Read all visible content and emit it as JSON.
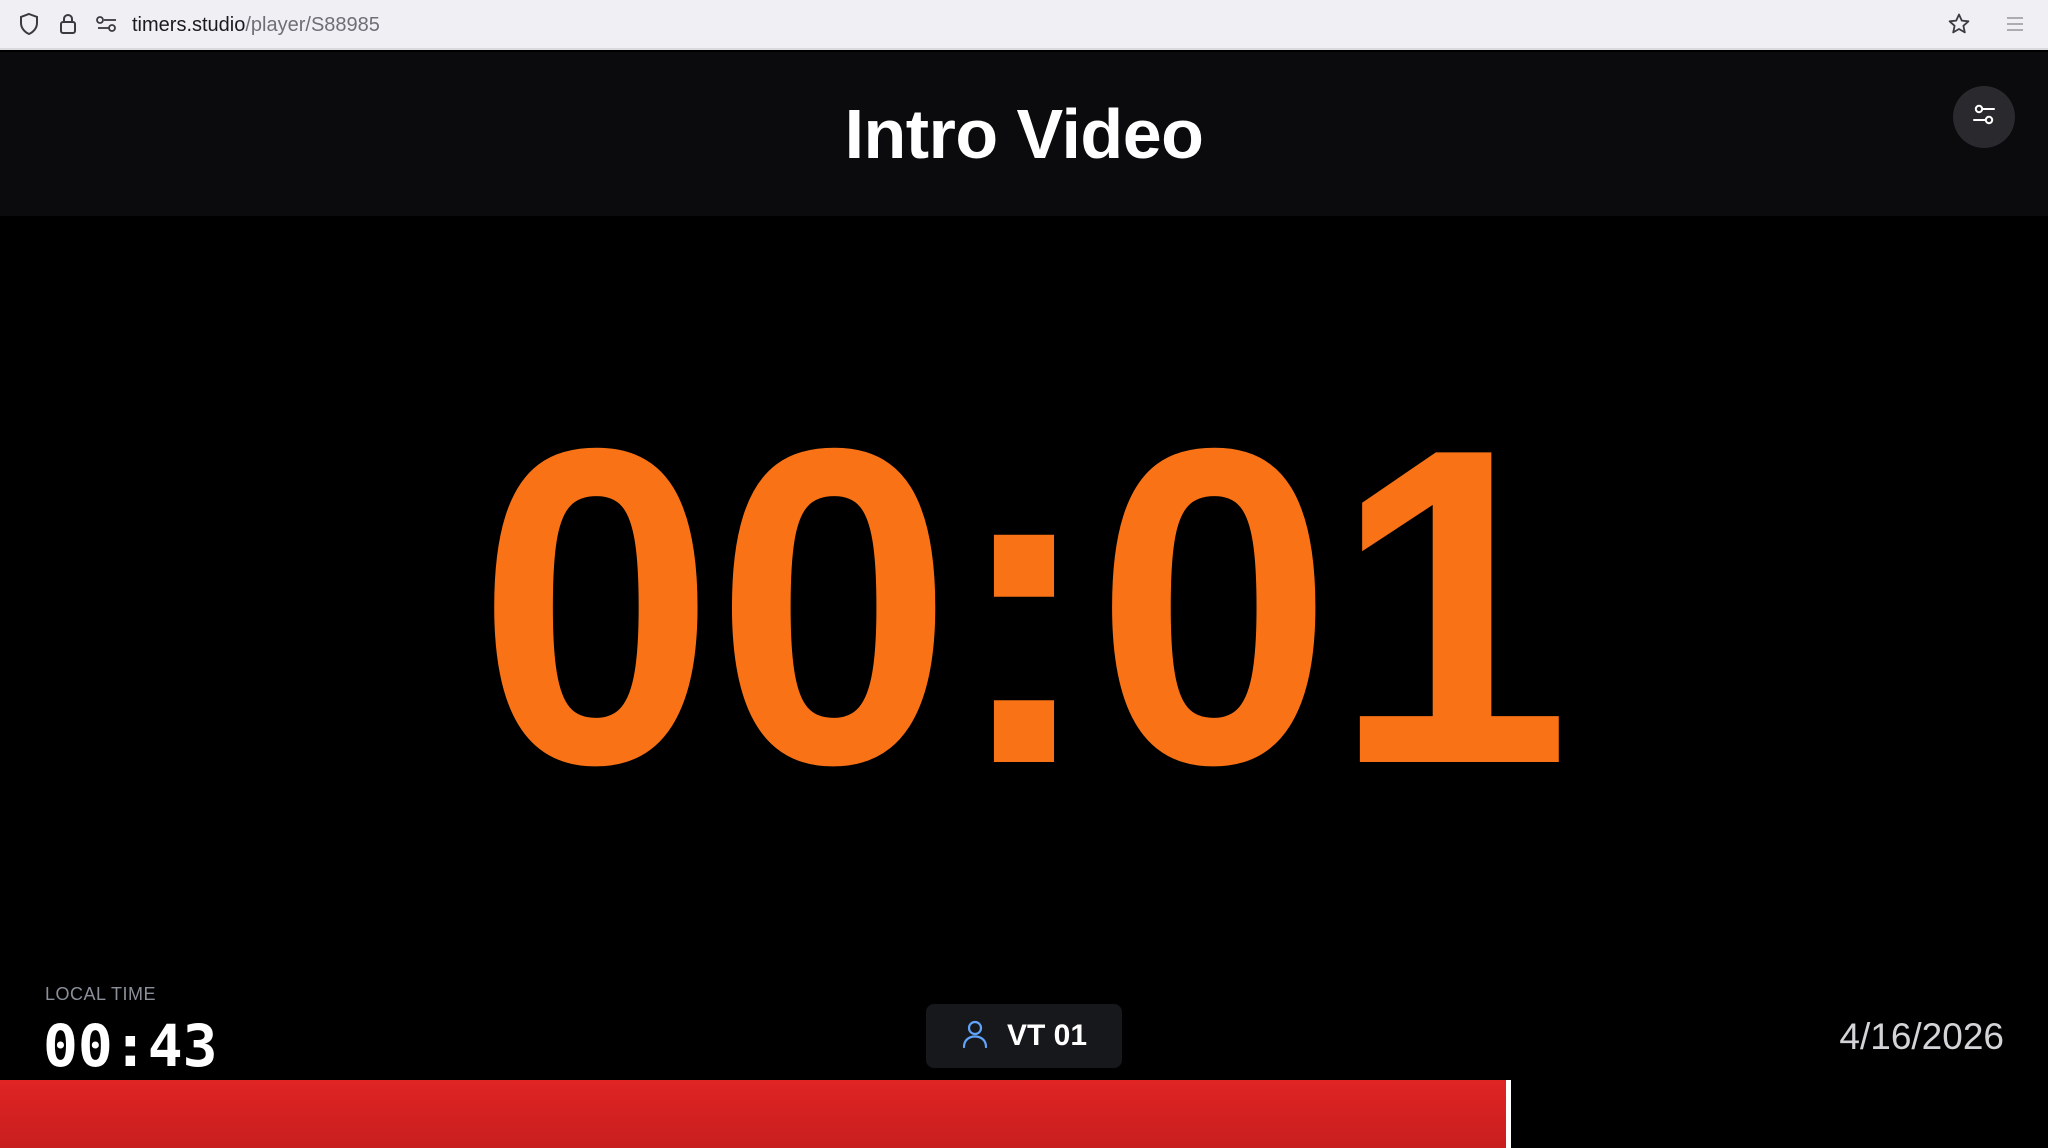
{
  "browser": {
    "url_host": "timers.studio",
    "url_path": "/player/S88985"
  },
  "header": {
    "title": "Intro Video"
  },
  "timer": {
    "display": "00:01",
    "color": "#f97316"
  },
  "footer": {
    "local_time_label": "LOCAL TIME",
    "local_time": "00:43",
    "speaker": "VT 01",
    "date": "4/16/2026"
  },
  "progress": {
    "fraction": 0.737,
    "fill_color": "#dc2626"
  },
  "icons": {
    "shield": "shield-icon",
    "lock": "lock-icon",
    "site_settings": "site-permissions-icon",
    "bookmark": "star-icon",
    "menu": "hamburger-menu-icon",
    "settings": "sliders-icon",
    "user": "user-icon"
  }
}
